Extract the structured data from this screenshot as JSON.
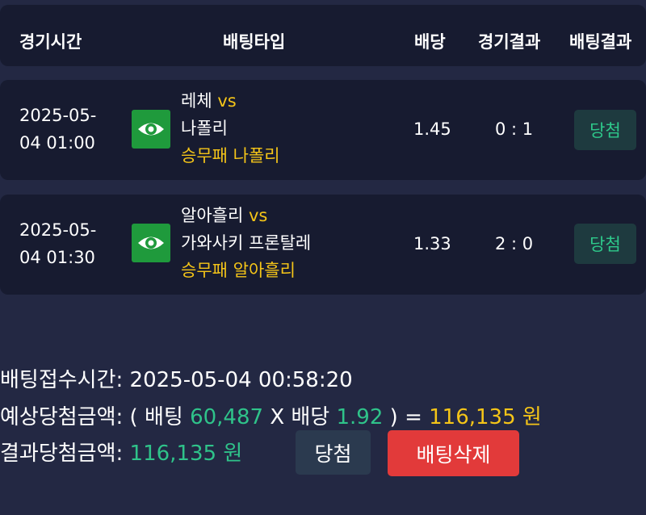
{
  "header": {
    "col_time": "경기시간",
    "col_type": "배팅타입",
    "col_odds": "배당",
    "col_result": "경기결과",
    "col_bet_result": "배팅결과"
  },
  "bets": [
    {
      "date": "2025-05-",
      "time": "04 01:00",
      "home": "레체",
      "vs": "vs",
      "away": "나폴리",
      "pick": "승무패 나폴리",
      "odds": "1.45",
      "score": "0 : 1",
      "result": "당첨",
      "icon": "eye-icon"
    },
    {
      "date": "2025-05-",
      "time": "04 01:30",
      "home": "알아흘리",
      "vs": "vs",
      "away": "가와사키 프론탈레",
      "pick": "승무패 알아흘리",
      "odds": "1.33",
      "score": "2 : 0",
      "result": "당첨",
      "icon": "eye-icon"
    }
  ],
  "summary": {
    "received_label": "배팅접수시간:",
    "received_value": "2025-05-04 00:58:20",
    "expected_label": "예상당첨금액:",
    "open_paren": "( 배팅",
    "stake": "60,487",
    "x_label": "X 배당",
    "total_odds": "1.92",
    "close_eq": ") =",
    "expected_amount": "116,135 원",
    "result_label": "결과당첨금액:",
    "result_amount": "116,135 원"
  },
  "actions": {
    "win_label": "당첨",
    "delete_label": "배팅삭제"
  },
  "colors": {
    "background": "#232843",
    "card": "#171b30",
    "accent_yellow": "#f5c518",
    "accent_green": "#2fc38a",
    "delete_red": "#e23a3a",
    "eye_green": "#1f9a3c"
  }
}
